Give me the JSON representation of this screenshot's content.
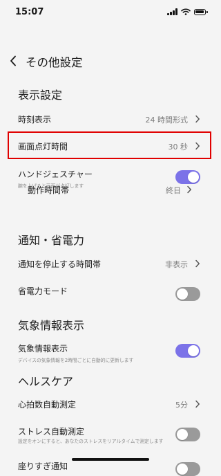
{
  "status_bar": {
    "time": "15:07"
  },
  "header": {
    "title": "その他設定"
  },
  "sections": {
    "display": {
      "title": "表示設定",
      "time_format": {
        "label": "時刻表示",
        "value": "24 時間形式"
      },
      "screen_on": {
        "label": "画面点灯時間",
        "value": "30 秒"
      },
      "hand_gesture": {
        "label": "ハンドジェスチャー",
        "desc": "腕を上げると画面が点灯します",
        "enabled": true
      },
      "active_hours": {
        "label": "動作時間帯",
        "value": "終日"
      }
    },
    "notification": {
      "title": "通知・省電力",
      "quiet_hours": {
        "label": "通知を停止する時間帯",
        "value": "非表示"
      },
      "power_saving": {
        "label": "省電力モード",
        "enabled": false
      }
    },
    "weather": {
      "title": "気象情報表示",
      "weather_display": {
        "label": "気象情報表示",
        "desc": "デバイスの気象情報を2時間ごとに自動的に更新します",
        "enabled": true
      }
    },
    "health": {
      "title": "ヘルスケア",
      "heart_rate": {
        "label": "心拍数自動測定",
        "value": "5分"
      },
      "stress": {
        "label": "ストレス自動測定",
        "desc": "設定をオンにすると、あなたのストレスをリアルタイムで測定します",
        "enabled": false
      },
      "sedentary": {
        "label": "座りすぎ通知",
        "enabled": false
      }
    }
  },
  "colors": {
    "accent": "#7b72e8",
    "toggle_off": "#9a9a9a",
    "highlight": "#e00000"
  }
}
